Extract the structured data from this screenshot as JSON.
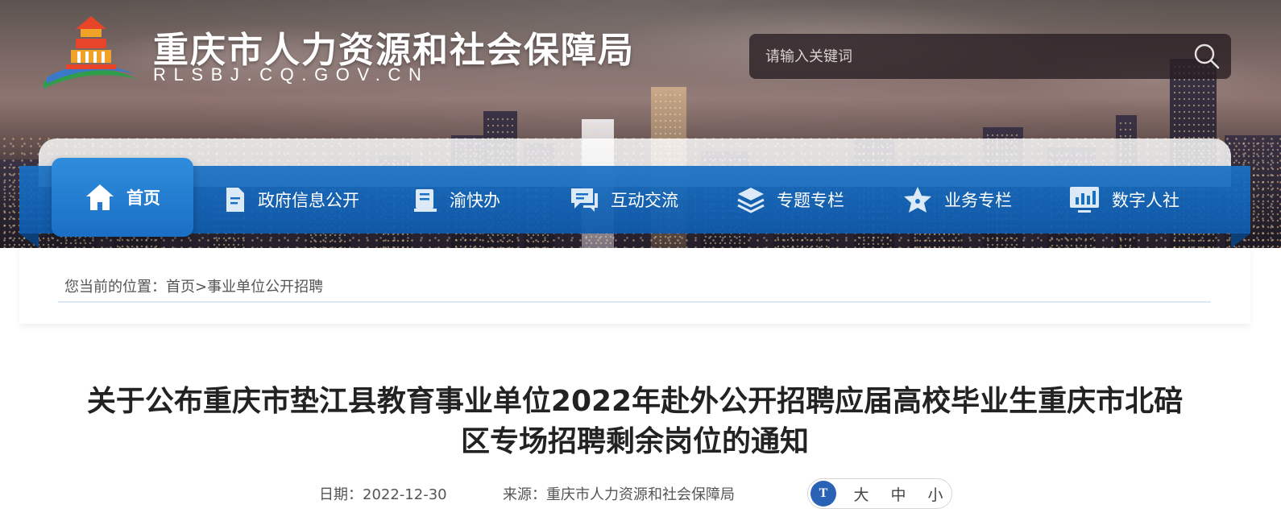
{
  "header": {
    "site_title": "重庆市人力资源和社会保障局",
    "site_domain": "RLSBJ.CQ.GOV.CN",
    "search_placeholder": "请输入关键词"
  },
  "nav": [
    {
      "label": "首页",
      "icon": "home-icon",
      "active": true
    },
    {
      "label": "政府信息公开",
      "icon": "document-icon"
    },
    {
      "label": "渝快办",
      "icon": "booklet-icon"
    },
    {
      "label": "互动交流",
      "icon": "chat-icon"
    },
    {
      "label": "专题专栏",
      "icon": "layers-icon"
    },
    {
      "label": "业务专栏",
      "icon": "star-icon"
    },
    {
      "label": "数字人社",
      "icon": "monitor-chart-icon"
    }
  ],
  "breadcrumb": {
    "prefix": "您当前的位置：",
    "home": "首页",
    "separator": ">",
    "current": "事业单位公开招聘"
  },
  "article": {
    "title": "关于公布重庆市垫江县教育事业单位2022年赴外公开招聘应届高校毕业生重庆市北碚区专场招聘剩余岗位的通知",
    "date": "日期：2022-12-30",
    "source": "来源：重庆市人力资源和社会保障局"
  },
  "font_size": {
    "icon_label": "T",
    "options": [
      "大",
      "中",
      "小"
    ]
  },
  "colors": {
    "nav_blue": "#1870c4",
    "active_blue": "#2f8ddd",
    "font_icon_blue": "#2a63b6"
  }
}
